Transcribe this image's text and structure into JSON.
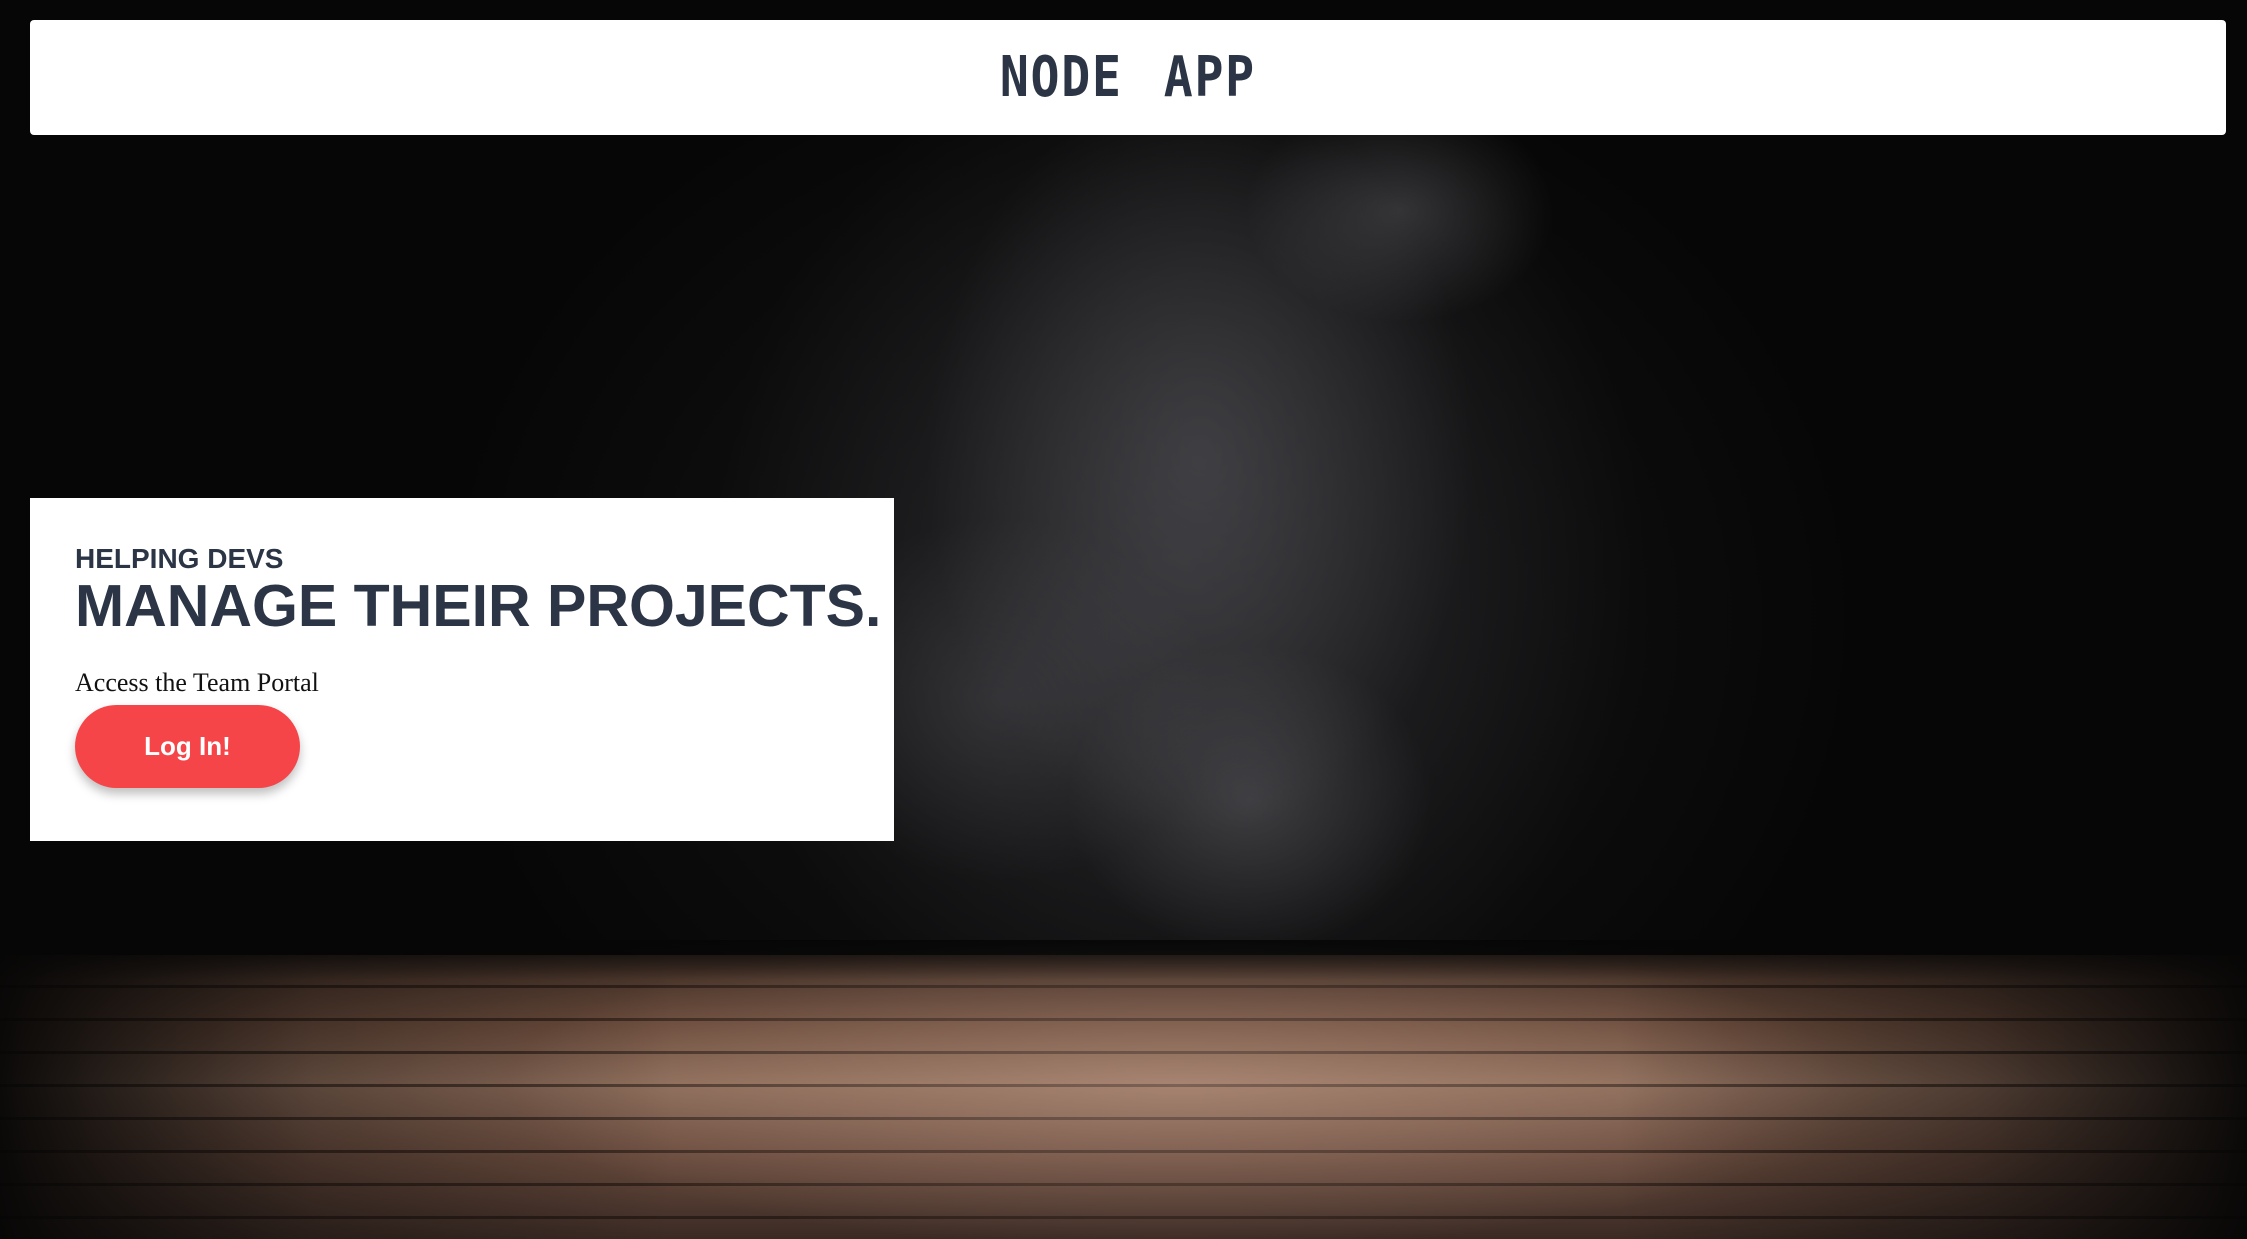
{
  "header": {
    "brand": "NODE APP"
  },
  "hero": {
    "eyebrow": "HELPING DEVS",
    "headline": "MANAGE THEIR PROJECTS.",
    "portal_text": "Access the Team Portal",
    "login_label": "Log In!"
  },
  "colors": {
    "brand_text": "#2b3545",
    "button": "#f64549",
    "card_background": "#ffffff"
  }
}
